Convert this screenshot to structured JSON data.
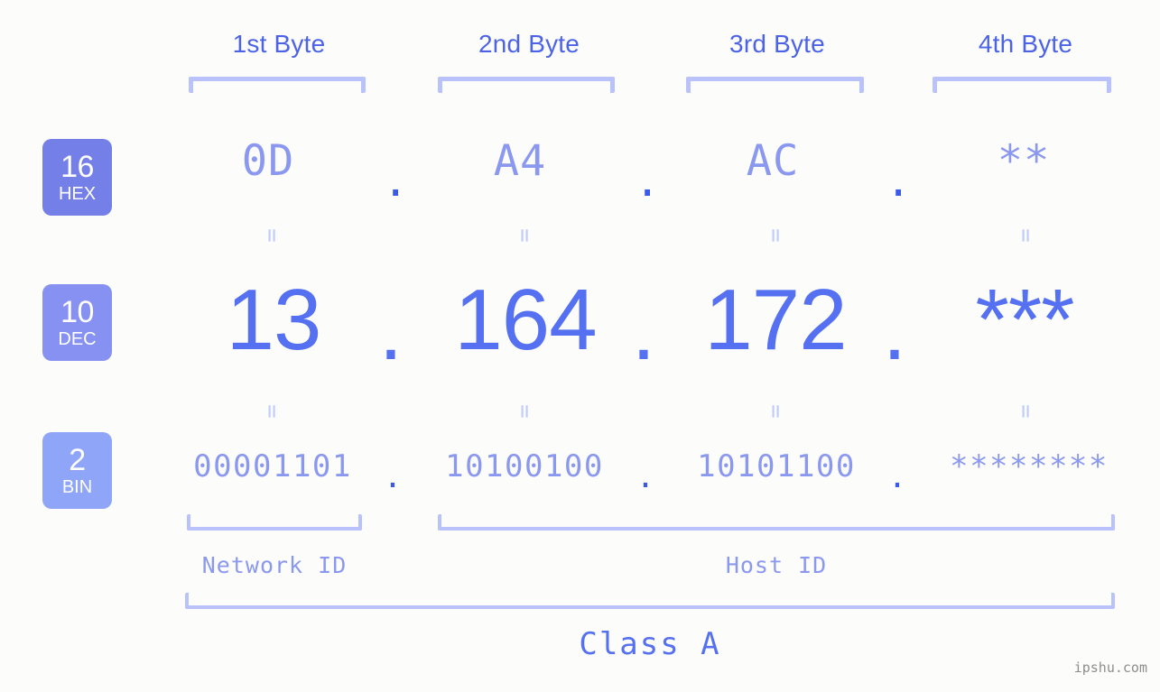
{
  "page": {
    "background": "#fcfdfa",
    "accent": "#5570f1",
    "accent_light": "#8b98f0",
    "bracket_color": "#b9c2fb",
    "watermark": "ipshu.com"
  },
  "byte_headers": [
    {
      "label": "1st Byte"
    },
    {
      "label": "2nd Byte"
    },
    {
      "label": "3rd Byte"
    },
    {
      "label": "4th Byte"
    }
  ],
  "bases": [
    {
      "num": "16",
      "name": "HEX",
      "color": "#757fe8"
    },
    {
      "num": "10",
      "name": "DEC",
      "color": "#8691f2"
    },
    {
      "num": "2",
      "name": "BIN",
      "color": "#8fa5f7"
    }
  ],
  "rows": {
    "hex": {
      "base_num": "16",
      "base_name": "HEX",
      "values": [
        "0D",
        "A4",
        "AC",
        "**"
      ],
      "separator": "."
    },
    "dec": {
      "base_num": "10",
      "base_name": "DEC",
      "values": [
        "13",
        "164",
        "172",
        "***"
      ],
      "separator": "."
    },
    "bin": {
      "base_num": "2",
      "base_name": "BIN",
      "values": [
        "00001101",
        "10100100",
        "10101100",
        "********"
      ],
      "separator": "."
    }
  },
  "equals_marks": {
    "glyph": "=",
    "count_per_row": 4
  },
  "segments": {
    "network_id": "Network ID",
    "host_id": "Host ID",
    "class": "Class A"
  }
}
